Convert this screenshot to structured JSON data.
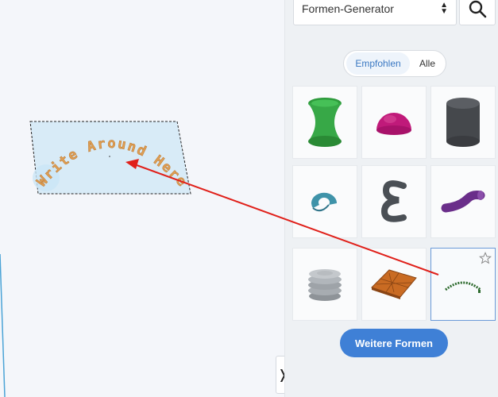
{
  "panel": {
    "generator_select": "Formen-Generator",
    "tabs": [
      {
        "label": "Empfohlen",
        "active": true
      },
      {
        "label": "Alle",
        "active": false
      }
    ],
    "shapes": [
      {
        "icon": "hyperboloid-icon",
        "color": "#2e9b3c"
      },
      {
        "icon": "hemisphere-icon",
        "color": "#c01a7a"
      },
      {
        "icon": "cylinder-icon",
        "color": "#4a4c50"
      },
      {
        "icon": "torus-piece-icon",
        "color": "#3f93a9"
      },
      {
        "icon": "letter-e-icon",
        "color": "#4a4f55"
      },
      {
        "icon": "curved-tube-icon",
        "color": "#6a2e8a"
      },
      {
        "icon": "screw-thread-icon",
        "color": "#9ea3a8"
      },
      {
        "icon": "tile-plate-icon",
        "color": "#c96b23"
      },
      {
        "icon": "text-arc-icon",
        "color": "#2e6b2e",
        "selected": true
      }
    ],
    "more_button": "Weitere Formen"
  },
  "workplane": {
    "arc_text": "Write Around Here",
    "arc_text_color": "#e0a055",
    "selection_fill": "#d8ebf7",
    "annotation_arrow_color": "#e0201a"
  }
}
